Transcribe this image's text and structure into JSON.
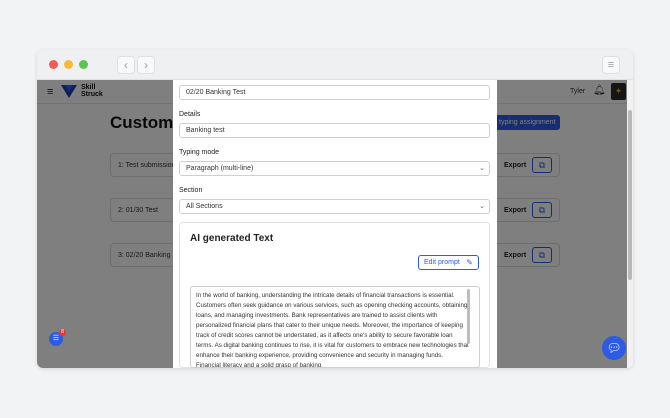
{
  "app": {
    "logo_line1": "Skill",
    "logo_line2": "Struck",
    "user_name": "Tyler",
    "page_title": "Custom",
    "new_assignment_label": "typing assignment",
    "assignments": [
      {
        "label": "1: Test submission",
        "export": "Export"
      },
      {
        "label": "2: 01/30 Test",
        "export": "Export"
      },
      {
        "label": "3: 02/20 Banking",
        "export": "Export"
      }
    ],
    "notification_count": "8"
  },
  "modal": {
    "title_value": "02/20 Banking Test",
    "details_label": "Details",
    "details_value": "Banking test",
    "typing_mode_label": "Typing mode",
    "typing_mode_value": "Paragraph (multi-line)",
    "section_label": "Section",
    "section_value": "All Sections",
    "ai_heading": "AI generated Text",
    "edit_prompt_label": "Edit prompt",
    "ai_text": "In the world of banking, understanding the intricate details of financial transactions is essential. Customers often seek guidance on various services, such as opening checking accounts, obtaining loans, and managing investments. Bank representatives are trained to assist clients with personalized financial plans that cater to their unique needs. Moreover, the importance of keeping track of credit scores cannot be understated, as it affects one's ability to secure favorable loan terms. As digital banking continues to rise, it is vital for customers to embrace new technologies that enhance their banking experience, providing convenience and security in managing funds. Financial literacy and a solid grasp of banking"
  },
  "icons": {
    "back": "chevron-left-icon",
    "forward": "chevron-right-icon",
    "menu": "menu-icon",
    "bell": "bell-icon",
    "pencil": "pencil-icon",
    "chat": "chat-icon"
  },
  "colors": {
    "accent": "#2d5be3",
    "overlay": "rgba(0,0,0,0.5)"
  }
}
